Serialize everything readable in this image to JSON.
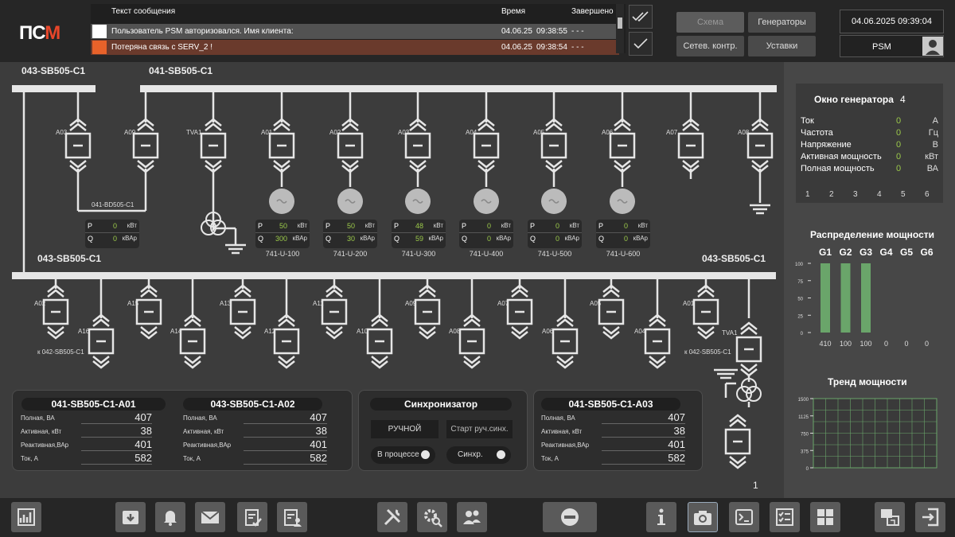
{
  "header": {
    "logo_prefix": "ПС",
    "logo_m": "М",
    "columns": {
      "text": "Текст сообщения",
      "time": "Время",
      "done": "Завершено"
    },
    "alarms": [
      {
        "text": "Пользователь PSM авторизовался. Имя клиента:",
        "date": "04.06.25",
        "time": "09:38:55",
        "done": "- - -",
        "color": "#ffffff"
      },
      {
        "text": "Потеряна связь с SERV_2 !",
        "date": "04.06.25",
        "time": "09:38:54",
        "done": "- - -",
        "color": "#e8622a"
      }
    ],
    "nav": {
      "scheme": "Схема",
      "generators": "Генераторы",
      "network": "Сетев. контр.",
      "settings": "Уставки"
    },
    "datetime": "04.06.2025  09:39:04",
    "user": "PSM"
  },
  "schematic": {
    "top_bus_left": "043-SB505-C1",
    "top_bus_right": "041-SB505-C1",
    "mid_bus_left": "043-SB505-C1",
    "mid_bus_right": "043-SB505-C1",
    "link_label": "041-BD505-C1",
    "top_breakers": [
      "A03",
      "A09",
      "TVA1",
      "A01",
      "A02",
      "A03",
      "A04",
      "A05",
      "A06",
      "A07",
      "A08"
    ],
    "link_pq": {
      "p": "0",
      "q": "0",
      "p_unit": "кВт",
      "q_unit": "кВАр"
    },
    "generators": [
      {
        "name": "741-U-100",
        "p": "50",
        "q": "300"
      },
      {
        "name": "741-U-200",
        "p": "50",
        "q": "30"
      },
      {
        "name": "741-U-300",
        "p": "48",
        "q": "59"
      },
      {
        "name": "741-U-400",
        "p": "0",
        "q": "0"
      },
      {
        "name": "741-U-500",
        "p": "0",
        "q": "0"
      },
      {
        "name": "741-U-600",
        "p": "0",
        "q": "0"
      }
    ],
    "bottom_breakers": [
      "A02",
      "A16",
      "A15",
      "A14",
      "A13",
      "A12",
      "A11",
      "A10",
      "A09",
      "A08",
      "A07",
      "A06",
      "A05",
      "A04",
      "A01",
      "TVA1"
    ],
    "feeder_left": "к 042-SB505-C1",
    "feeder_right": "к 042-SB505-C1",
    "page_number": "1"
  },
  "panels": {
    "a01": {
      "title": "041-SB505-C1-A01",
      "rows": [
        {
          "k": "Полная, ВА",
          "v": "407"
        },
        {
          "k": "Активная, кВт",
          "v": "38"
        },
        {
          "k": "Реактивная,ВАр",
          "v": "401"
        },
        {
          "k": "Ток, А",
          "v": "582"
        }
      ]
    },
    "a02": {
      "title": "043-SB505-C1-A02",
      "rows": [
        {
          "k": "Полная, ВА",
          "v": "407"
        },
        {
          "k": "Активная, кВт",
          "v": "38"
        },
        {
          "k": "Реактивная,ВАр",
          "v": "401"
        },
        {
          "k": "Ток, А",
          "v": "582"
        }
      ]
    },
    "sync": {
      "title": "Синхронизатор",
      "manual": "РУЧНОЙ",
      "start": "Старт руч.синх.",
      "in_progress": "В процессе",
      "synced": "Синхр."
    },
    "a03": {
      "title": "041-SB505-C1-A03",
      "rows": [
        {
          "k": "Полная, ВА",
          "v": "407"
        },
        {
          "k": "Активная, кВт",
          "v": "38"
        },
        {
          "k": "Реактивная,ВАр",
          "v": "401"
        },
        {
          "k": "Ток, А",
          "v": "582"
        }
      ]
    }
  },
  "generator_window": {
    "title": "Окно генератора",
    "number": "4",
    "rows": [
      {
        "k": "Ток",
        "v": "0",
        "u": "А"
      },
      {
        "k": "Частота",
        "v": "0",
        "u": "Гц"
      },
      {
        "k": "Напряжение",
        "v": "0",
        "u": "В"
      },
      {
        "k": "Активная мощность",
        "v": "0",
        "u": "кВт"
      },
      {
        "k": "Полная мощность",
        "v": "0",
        "u": "ВА"
      }
    ],
    "selectors": [
      "1",
      "2",
      "3",
      "4",
      "5",
      "6"
    ]
  },
  "power_dist": {
    "title": "Распределение мощности",
    "chart_data": {
      "type": "bar",
      "categories": [
        "G1",
        "G2",
        "G3",
        "G4",
        "G5",
        "G6"
      ],
      "values": [
        410,
        100,
        100,
        0,
        0,
        0
      ],
      "bar_levels": [
        100,
        100,
        100,
        0,
        0,
        0
      ],
      "ylim": [
        0,
        100
      ],
      "yticks": [
        "100",
        "75",
        "50",
        "25",
        "0"
      ],
      "value_labels": [
        "410",
        "100",
        "100",
        "0",
        "0",
        "0"
      ],
      "bar_color": "#6aa56a"
    }
  },
  "trend": {
    "title": "Тренд мощности",
    "chart_data": {
      "type": "line",
      "ylim": [
        0,
        1500
      ],
      "yticks": [
        "1500",
        "1125",
        "750",
        "375",
        "0"
      ],
      "series": []
    }
  },
  "footer": {
    "icons": [
      "chart-icon",
      "archive-icon",
      "bell-icon",
      "mail-icon",
      "clipboard-check-icon",
      "clipboard-user-icon",
      "tools-icon",
      "gear-search-icon",
      "users-icon",
      "stop-icon",
      "info-icon",
      "camera-icon",
      "terminal-icon",
      "checklist-icon",
      "grid-icon",
      "windows-icon",
      "exit-icon"
    ]
  }
}
